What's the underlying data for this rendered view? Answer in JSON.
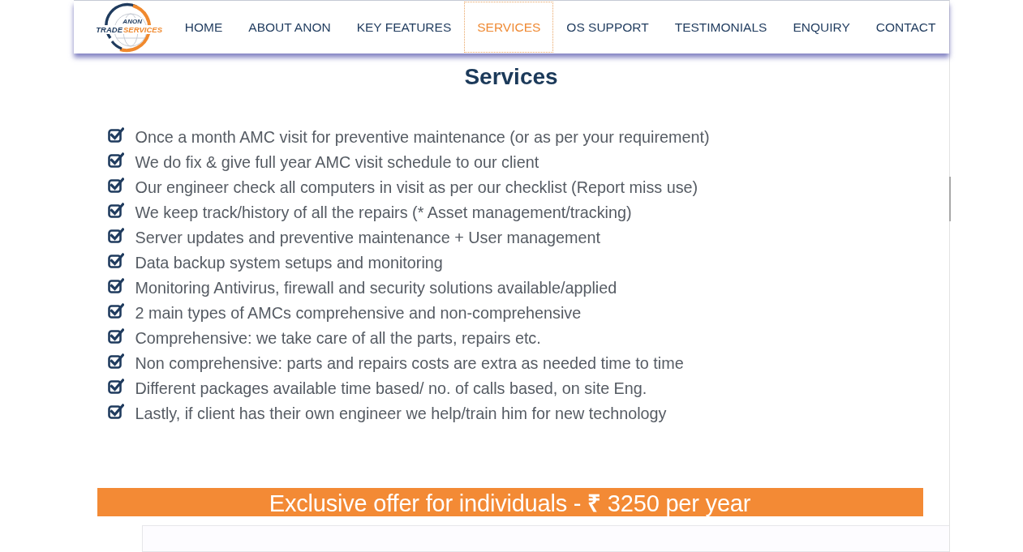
{
  "header": {
    "logo": {
      "top": "ANON",
      "left": "TRADE",
      "right": "SERVICES"
    },
    "nav": [
      {
        "label": "HOME",
        "selected": false
      },
      {
        "label": "ABOUT ANON",
        "selected": false
      },
      {
        "label": "KEY FEATURES",
        "selected": false
      },
      {
        "label": "SERVICES",
        "selected": true
      },
      {
        "label": "OS SUPPORT",
        "selected": false
      },
      {
        "label": "TESTIMONIALS",
        "selected": false
      },
      {
        "label": "ENQUIRY",
        "selected": false
      },
      {
        "label": "CONTACT",
        "selected": false
      }
    ]
  },
  "heading": "Services",
  "services": [
    "Once a month AMC visit for preventive maintenance (or as per your requirement)",
    "We do fix & give full year AMC visit schedule to our client",
    "Our engineer check all computers in visit as per our checklist (Report miss use)",
    "We keep track/history of all the repairs (* Asset management/tracking)",
    "Server updates and preventive maintenance + User management",
    "Data backup system setups and monitoring",
    "Monitoring Antivirus, firewall and security solutions available/applied",
    "2 main types of AMCs comprehensive and non-comprehensive",
    "Comprehensive: we take care of all the parts, repairs etc.",
    "Non comprehensive: parts and repairs costs are extra as needed time to time",
    "Different packages available time based/ no. of calls based, on site Eng.",
    "Lastly, if client has their own engineer we help/train him for new technology"
  ],
  "offer_banner": {
    "text": "Exclusive offer for individuals - **₹** 3250 per year"
  }
}
